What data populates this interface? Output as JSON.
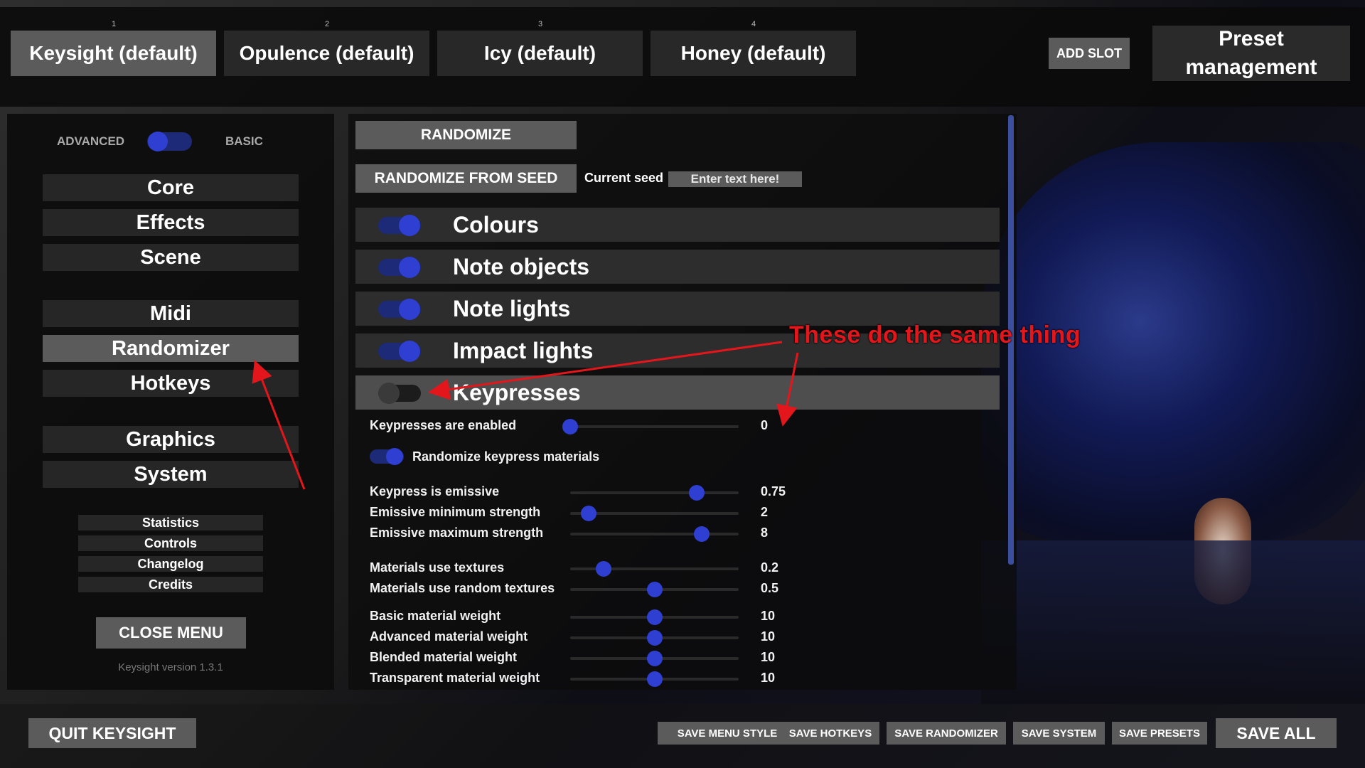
{
  "top_bar": {
    "slots": [
      {
        "number": "1",
        "label": "Keysight (default)"
      },
      {
        "number": "2",
        "label": "Opulence (default)"
      },
      {
        "number": "3",
        "label": "Icy (default)"
      },
      {
        "number": "4",
        "label": "Honey (default)"
      }
    ],
    "add_slot_label": "ADD SLOT",
    "preset_management_label": "Preset management"
  },
  "sidebar": {
    "mode_left": "ADVANCED",
    "mode_right": "BASIC",
    "nav": {
      "core": "Core",
      "effects": "Effects",
      "scene": "Scene",
      "midi": "Midi",
      "randomizer": "Randomizer",
      "hotkeys": "Hotkeys",
      "graphics": "Graphics",
      "system": "System"
    },
    "small": {
      "statistics": "Statistics",
      "controls": "Controls",
      "changelog": "Changelog",
      "credits": "Credits"
    },
    "close_menu_label": "CLOSE MENU",
    "version": "Keysight version 1.3.1"
  },
  "main": {
    "randomize_label": "RANDOMIZE",
    "randomize_seed_label": "RANDOMIZE FROM SEED",
    "current_seed_label": "Current seed",
    "seed_placeholder": "Enter text here!",
    "categories": {
      "colours": "Colours",
      "note_objects": "Note objects",
      "note_lights": "Note lights",
      "impact_lights": "Impact lights",
      "keypresses": "Keypresses"
    },
    "settings": {
      "enabled": {
        "label": "Keypresses are enabled",
        "value": "0",
        "fraction": 0.0
      },
      "randomize_materials": {
        "label": "Randomize keypress materials"
      },
      "emissive": {
        "label": "Keypress is emissive",
        "value": "0.75",
        "fraction": 0.75
      },
      "emissive_min": {
        "label": "Emissive minimum strength",
        "value": "2",
        "fraction": 0.11
      },
      "emissive_max": {
        "label": "Emissive maximum strength",
        "value": "8",
        "fraction": 0.78
      },
      "use_textures": {
        "label": "Materials use textures",
        "value": "0.2",
        "fraction": 0.2
      },
      "random_textures": {
        "label": "Materials use random textures",
        "value": "0.5",
        "fraction": 0.5
      },
      "basic_weight": {
        "label": "Basic material weight",
        "value": "10",
        "fraction": 0.5
      },
      "advanced_weight": {
        "label": "Advanced material weight",
        "value": "10",
        "fraction": 0.5
      },
      "blended_weight": {
        "label": "Blended material weight",
        "value": "10",
        "fraction": 0.5
      },
      "transparent_weight": {
        "label": "Transparent material weight",
        "value": "10",
        "fraction": 0.5
      }
    }
  },
  "bottom_bar": {
    "quit_label": "QUIT KEYSIGHT",
    "save_menu_style": "SAVE MENU STYLE",
    "save_hotkeys": "SAVE HOTKEYS",
    "save_randomizer": "SAVE RANDOMIZER",
    "save_system": "SAVE SYSTEM",
    "save_presets": "SAVE PRESETS",
    "save_all": "SAVE ALL"
  },
  "annotation": {
    "text": "These do the same thing",
    "color": "#e3161b"
  },
  "colors": {
    "toggle_on_knob": "#2f3fd2",
    "toggle_on_track": "#1c2a78",
    "toggle_off_knob": "#3a3a3a",
    "active_button": "#5b5b5b"
  }
}
